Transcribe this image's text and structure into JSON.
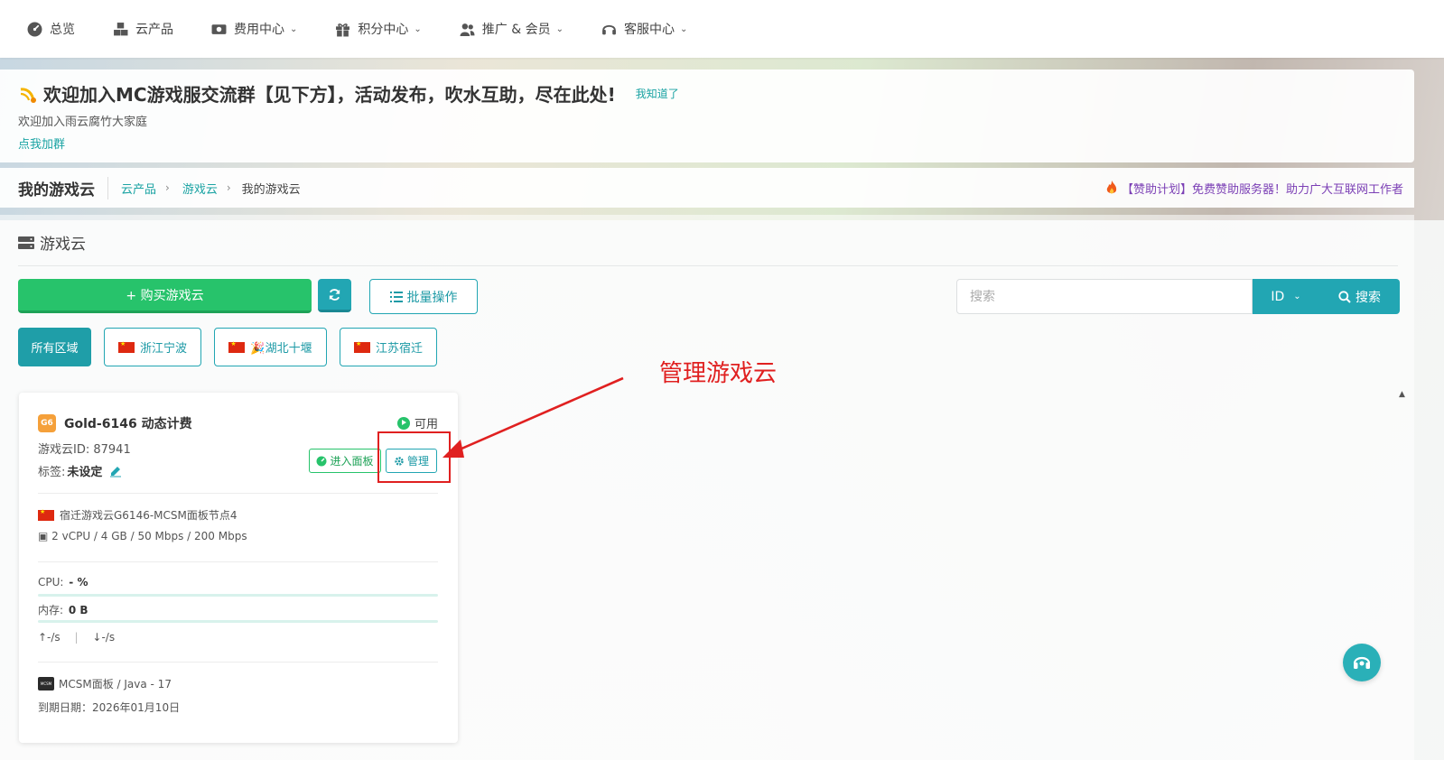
{
  "nav": {
    "items": [
      {
        "label": "总览",
        "icon": "dashboard-icon",
        "dropdown": false
      },
      {
        "label": "云产品",
        "icon": "cubes-icon",
        "dropdown": false
      },
      {
        "label": "费用中心",
        "icon": "money-icon",
        "dropdown": true
      },
      {
        "label": "积分中心",
        "icon": "gift-icon",
        "dropdown": true
      },
      {
        "label": "推广 & 会员",
        "icon": "users-icon",
        "dropdown": true
      },
      {
        "label": "客服中心",
        "icon": "headset-icon",
        "dropdown": true
      }
    ]
  },
  "notice": {
    "title": "欢迎加入MC游戏服交流群【见下方】，活动发布，吹水互助，尽在此处!",
    "dismiss": "我知道了",
    "subtitle": "欢迎加入雨云腐竹大家庭",
    "link": "点我加群"
  },
  "breadcrumb": {
    "page_title": "我的游戏云",
    "items": [
      "云产品",
      "游戏云"
    ],
    "current": "我的游戏云",
    "promo": "【赞助计划】免费赞助服务器！助力广大互联网工作者"
  },
  "section": {
    "title": "游戏云",
    "buy_label": "+ 购买游戏云",
    "batch_label": "批量操作",
    "search_placeholder": "搜索",
    "search_type": "ID",
    "search_button": "搜索"
  },
  "regions": [
    {
      "label": "所有区域",
      "active": true,
      "flag": false
    },
    {
      "label": "浙江宁波",
      "active": false,
      "flag": true
    },
    {
      "label": "🎉湖北十堰",
      "active": false,
      "flag": true
    },
    {
      "label": "江苏宿迁",
      "active": false,
      "flag": true
    }
  ],
  "card": {
    "badge": "G6",
    "title": "Gold-6146 动态计费",
    "status": "可用",
    "id_line": "游戏云ID: 87941",
    "tag_label": "标签:",
    "tag_value": "未设定",
    "panel_button": "进入面板",
    "manage_button": "管理",
    "node": "宿迁游戏云G6146-MCSM面板节点4",
    "specs": "2 vCPU / 4 GB / 50 Mbps / 200 Mbps",
    "cpu_label": "CPU:",
    "cpu_value": "- %",
    "cpu_fraction": 0,
    "mem_label": "内存:",
    "mem_value": "0 B",
    "mem_fraction": 0,
    "net_up": "↑-/s",
    "net_down": "↓-/s",
    "runtime": "MCSM面板 / Java - 17",
    "expire": "到期日期：2026年01月10日"
  },
  "annotation": {
    "text": "管理游戏云",
    "color": "#e02020"
  },
  "colors": {
    "accent": "#22a6b3",
    "success": "#27c36b",
    "promo": "#7b3fb5"
  }
}
